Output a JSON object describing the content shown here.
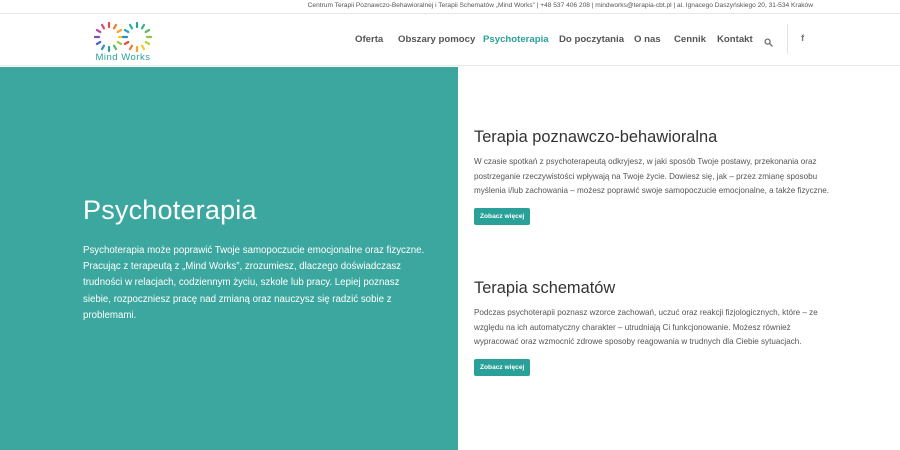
{
  "topbar": {
    "info": "Centrum Terapii Poznawczo-Behawioralnej i Terapii Schematów „Mind Works” | +48 537 406 208 | mindworks@terapia-cbt.pl | al. Ignacego Daszyńskiego 20, 31-534 Kraków"
  },
  "logo": {
    "text": "Mind Works"
  },
  "nav": {
    "items": [
      {
        "label": "Oferta"
      },
      {
        "label": "Obszary pomocy"
      },
      {
        "label": "Psychoterapia",
        "active": true
      },
      {
        "label": "Do poczytania"
      },
      {
        "label": "O nas"
      },
      {
        "label": "Cennik"
      },
      {
        "label": "Kontakt"
      }
    ],
    "facebook": "f"
  },
  "hero": {
    "title": "Psychoterapia",
    "text": "Psychoterapia może poprawić Twoje samopoczucie emocjonalne oraz fizyczne. Pracując z terapeutą z „Mind Works”, zrozumiesz, dlaczego doświadczasz trudności w relacjach, codziennym życiu, szkole lub pracy. Lepiej poznasz siebie, rozpoczniesz pracę nad zmianą oraz nauczysz się radzić sobie z problemami."
  },
  "sections": [
    {
      "title": "Terapia poznawczo-behawioralna",
      "text": "W czasie spotkań z psychoterapeutą odkryjesz, w jaki sposób Twoje postawy, przekonania oraz postrzeganie rzeczywistości wpływają na Twoje życie. Dowiesz się, jak – przez zmianę sposobu myślenia i/lub zachowania – możesz poprawić swoje samopoczucie emocjonalne, a także fizyczne.",
      "button": "Zobacz więcej"
    },
    {
      "title": "Terapia schematów",
      "text": "Podczas psychoterapii poznasz wzorce zachowań, uczuć oraz reakcji fizjologicznych, które – ze względu na ich automatyczny charakter – utrudniają Ci funkcjonowanie. Możesz również wypracować oraz wzmocnić zdrowe sposoby reagowania w trudnych dla Ciebie sytuacjach.",
      "button": "Zobacz więcej"
    }
  ],
  "colors": {
    "accent": "#2aa198",
    "hero_bg": "#3ca79f"
  },
  "icons": {
    "search": "search-icon",
    "facebook": "facebook-icon",
    "logo": "infinity-logo-icon"
  }
}
